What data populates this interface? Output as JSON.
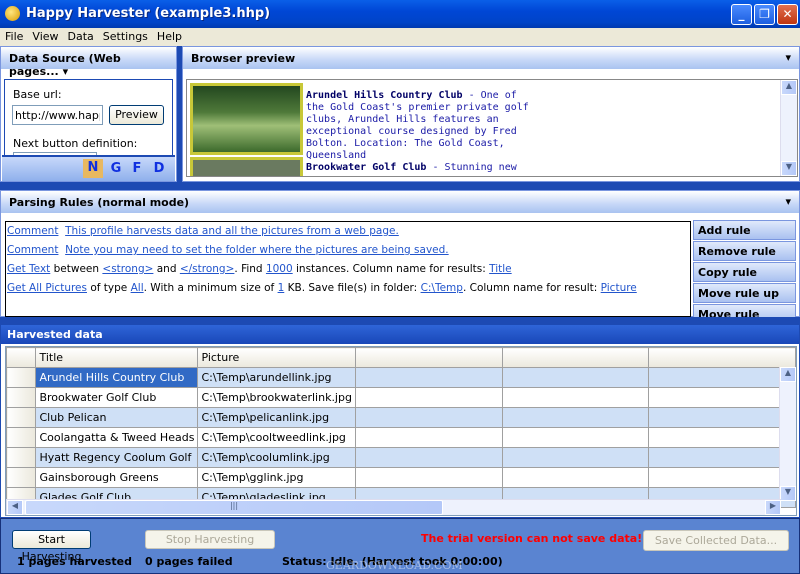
{
  "window": {
    "title": "Happy Harvester (example3.hhp)",
    "minimize": "_",
    "maximize": "❐",
    "close": "✕"
  },
  "menu": [
    "File",
    "View",
    "Data",
    "Settings",
    "Help"
  ],
  "data_source": {
    "title": "Data Source (Web pages...",
    "base_url_label": "Base url:",
    "base_url_value": "http://www.happ",
    "preview_button": "Preview",
    "next_button_label": "Next button definition:",
    "tabs": [
      "N",
      "G",
      "F",
      "D"
    ],
    "active_tab": "N"
  },
  "browser": {
    "title": "Browser preview",
    "entries": [
      {
        "name": "Arundel Hills Country Club",
        "text": " - One of the Gold Coast's premier private golf clubs, Arundel Hills features an exceptional course designed by Fred Bolton. Location: The Gold Coast, Queensland"
      },
      {
        "name": "Brookwater Golf Club",
        "text": " - Stunning new"
      }
    ]
  },
  "parsing": {
    "title": "Parsing Rules (normal mode)",
    "rules": [
      [
        {
          "t": "Comment",
          "l": true
        },
        {
          "t": "  ",
          "l": false
        },
        {
          "t": "This profile harvests data and all the pictures from a web page.",
          "l": true
        }
      ],
      [
        {
          "t": "Comment",
          "l": true
        },
        {
          "t": "  ",
          "l": false
        },
        {
          "t": "Note you may need to set the folder where the pictures are being saved.",
          "l": true
        }
      ],
      [
        {
          "t": "Get Text",
          "l": true
        },
        {
          "t": " between ",
          "l": false
        },
        {
          "t": "<strong>",
          "l": true
        },
        {
          "t": " and ",
          "l": false
        },
        {
          "t": "</strong>",
          "l": true
        },
        {
          "t": ". Find ",
          "l": false
        },
        {
          "t": "1000",
          "l": true
        },
        {
          "t": " instances. Column name for results: ",
          "l": false
        },
        {
          "t": "Title",
          "l": true
        }
      ],
      [
        {
          "t": "Get All Pictures",
          "l": true
        },
        {
          "t": " of type ",
          "l": false
        },
        {
          "t": "All",
          "l": true
        },
        {
          "t": ". With a minimum size of ",
          "l": false
        },
        {
          "t": "1",
          "l": true
        },
        {
          "t": " KB. Save file(s) in folder: ",
          "l": false
        },
        {
          "t": "C:\\Temp",
          "l": true
        },
        {
          "t": ". Column name for result: ",
          "l": false
        },
        {
          "t": "Picture",
          "l": true
        }
      ]
    ],
    "buttons": [
      "Add rule",
      "Remove rule",
      "Copy rule",
      "Move rule up",
      "Move rule down"
    ]
  },
  "harvested": {
    "title": "Harvested data",
    "columns": [
      "Title",
      "Picture"
    ],
    "rows": [
      [
        "Arundel Hills Country Club",
        "C:\\Temp\\arundellink.jpg"
      ],
      [
        "Brookwater Golf Club",
        "C:\\Temp\\brookwaterlink.jpg"
      ],
      [
        "Club Pelican",
        "C:\\Temp\\pelicanlink.jpg"
      ],
      [
        "Coolangatta & Tweed Heads",
        "C:\\Temp\\cooltweedlink.jpg"
      ],
      [
        "Hyatt Regency Coolum Golf",
        "C:\\Temp\\coolumlink.jpg"
      ],
      [
        "Gainsborough Greens",
        "C:\\Temp\\gglink.jpg"
      ],
      [
        "Glades Golf Club",
        "C:\\Temp\\gladeslink.jpg"
      ]
    ]
  },
  "bottom": {
    "start": "Start Harvesting",
    "stop": "Stop Harvesting",
    "trial_warning": "The trial version can not save data!",
    "save": "Save Collected Data...",
    "harvested_count": "1 pages harvested",
    "failed_count": "0 pages failed",
    "status": "Status: Idle. (Harvest took 0:00:00)",
    "watermark": "GEARDOWNLOAD.COM"
  },
  "colors": {
    "title_bar": "#0046d5",
    "accent": "#316ac5",
    "warning": "#ff0000",
    "bottom_bar": "#5a84d1"
  }
}
